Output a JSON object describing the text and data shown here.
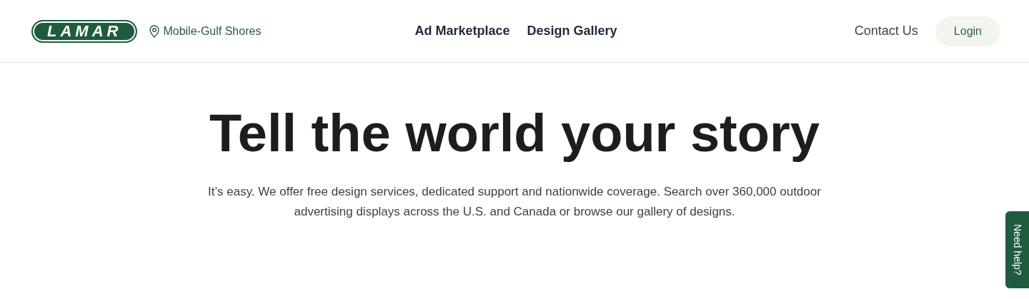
{
  "header": {
    "logo": "LAMAR",
    "location": "Mobile-Gulf Shores",
    "nav": [
      {
        "label": "Ad Marketplace"
      },
      {
        "label": "Design Gallery"
      }
    ],
    "contact": "Contact Us",
    "login": "Login"
  },
  "hero": {
    "title": "Tell the world your story",
    "text": "It’s easy. We offer free design services, dedicated support and nationwide coverage. Search over 360,000 outdoor advertising displays across the U.S. and Canada or browse our gallery of designs."
  },
  "help_tab": "Need help?"
}
